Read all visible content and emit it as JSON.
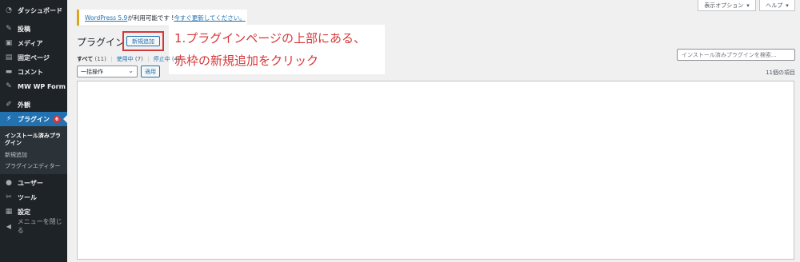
{
  "sidebar": {
    "items": [
      {
        "label": "ダッシュボード",
        "icon": "dashboard-icon",
        "glyph": "◔"
      },
      {
        "label": "投稿",
        "icon": "pin-icon",
        "glyph": "✎"
      },
      {
        "label": "メディア",
        "icon": "media-icon",
        "glyph": "▣"
      },
      {
        "label": "固定ページ",
        "icon": "page-icon",
        "glyph": "▤"
      },
      {
        "label": "コメント",
        "icon": "comment-icon",
        "glyph": "▬"
      },
      {
        "label": "MW WP Form",
        "icon": "pin-icon",
        "glyph": "✎"
      },
      {
        "label": "外観",
        "icon": "appearance-icon",
        "glyph": "✐"
      },
      {
        "label": "プラグイン",
        "icon": "plugin-icon",
        "glyph": "⚡",
        "badge": "6"
      }
    ],
    "submenu": [
      "インストール済みプラグイン",
      "新規追加",
      "プラグインエディター"
    ],
    "items_after": [
      {
        "label": "ユーザー",
        "icon": "user-icon",
        "glyph": "●"
      },
      {
        "label": "ツール",
        "icon": "tools-icon",
        "glyph": "✂"
      },
      {
        "label": "設定",
        "icon": "settings-icon",
        "glyph": "▦"
      }
    ],
    "collapse": "メニューを閉じる"
  },
  "top_tabs": {
    "screen_options": "表示オプション",
    "help": "ヘルプ"
  },
  "notice": {
    "link1": "WordPress 5.9",
    "text": " が利用可能です ! ",
    "link2": "今すぐ更新してください。"
  },
  "page": {
    "title": "プラグイン",
    "add_new": "新規追加"
  },
  "annotation": {
    "line1": "1.プラグインページの上部にある、",
    "line2": "赤枠の新規追加をクリック"
  },
  "filters": {
    "all": "すべて",
    "all_count": "(11)",
    "active": "使用中",
    "active_count": "(7)",
    "inactive": "停止中",
    "inactive_count": "(4)"
  },
  "bulk": {
    "selected": "一括操作",
    "apply": "適用"
  },
  "search": {
    "placeholder": "インストール済みプラグインを検索..."
  },
  "item_count": "11個の項目",
  "colors": {
    "accent": "#2271b1",
    "sidebar": "#1d2327",
    "alert": "#d63638",
    "notice": "#dba617"
  }
}
